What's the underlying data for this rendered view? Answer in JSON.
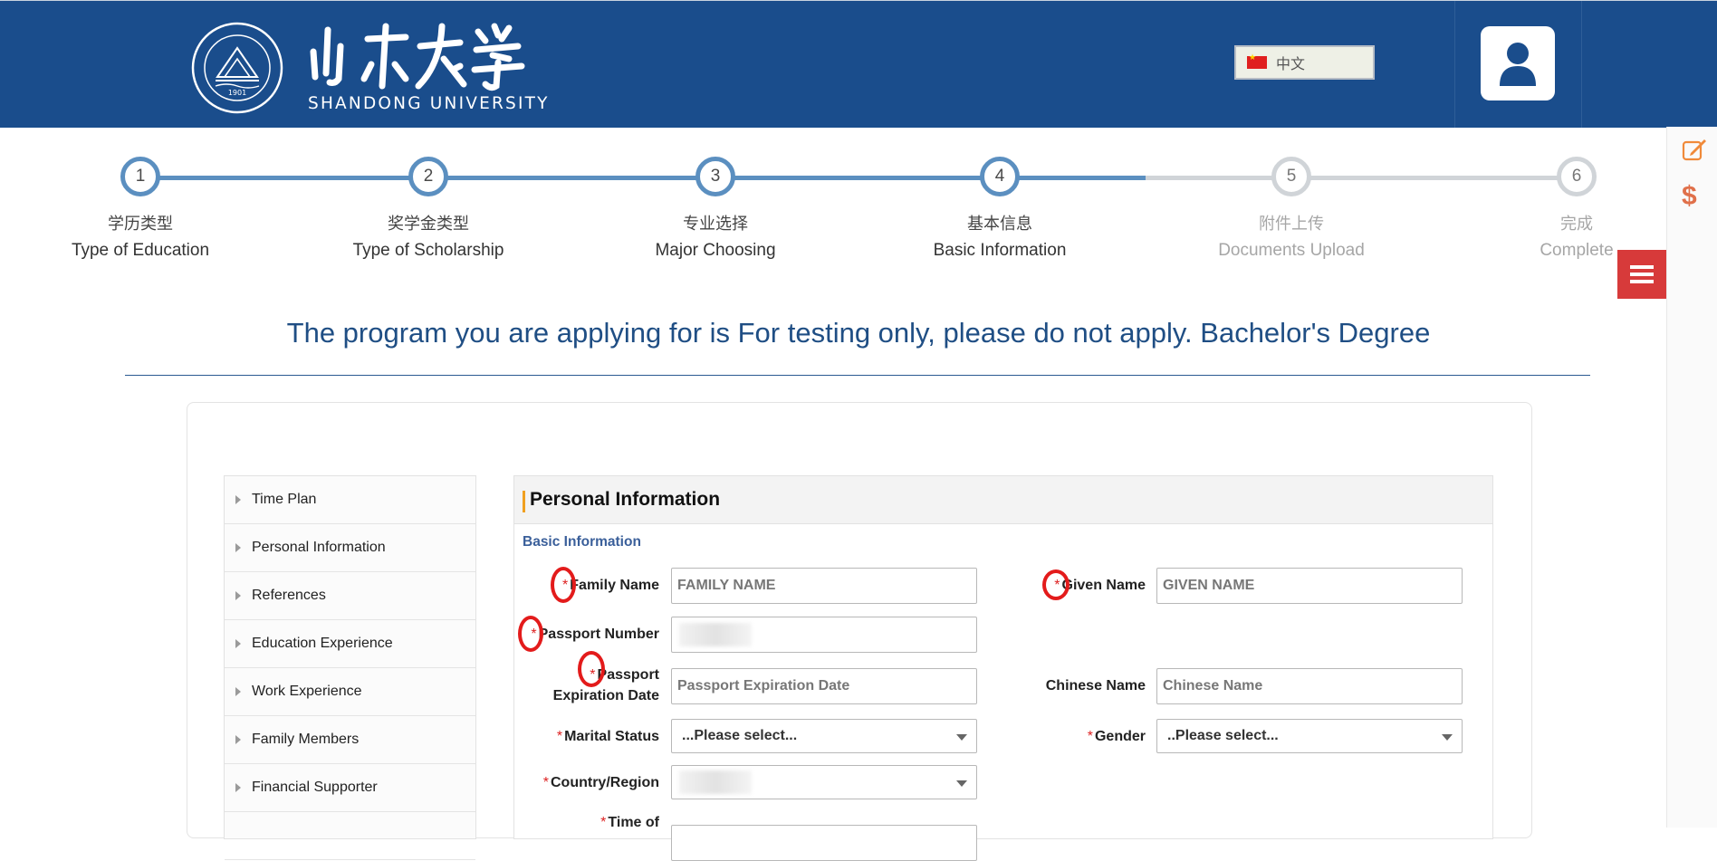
{
  "header": {
    "university_cn": "山东大学",
    "university_en": "SHANDONG UNIVERSITY",
    "seal_year": "1901",
    "seal_ring_text": "SHANDONG UNIVERSITY",
    "language_button": "中文",
    "brand_color": "#1a4d8c"
  },
  "steps": [
    {
      "num": "1",
      "cn": "学历类型",
      "en": "Type of Education",
      "state": "done"
    },
    {
      "num": "2",
      "cn": "奖学金类型",
      "en": "Type of Scholarship",
      "state": "done"
    },
    {
      "num": "3",
      "cn": "专业选择",
      "en": "Major Choosing",
      "state": "done"
    },
    {
      "num": "4",
      "cn": "基本信息",
      "en": "Basic Information",
      "state": "current"
    },
    {
      "num": "5",
      "cn": "附件上传",
      "en": "Documents Upload",
      "state": "pending"
    },
    {
      "num": "6",
      "cn": "完成",
      "en": "Complete",
      "state": "pending"
    }
  ],
  "program_title": "The program you are applying for is For testing only, please do not apply. Bachelor's Degree",
  "sidebar": {
    "items": [
      {
        "label": "Time Plan"
      },
      {
        "label": "Personal Information"
      },
      {
        "label": "References"
      },
      {
        "label": "Education Experience"
      },
      {
        "label": "Work Experience"
      },
      {
        "label": "Family Members"
      },
      {
        "label": "Financial Supporter"
      }
    ]
  },
  "form": {
    "panel_title": "Personal Information",
    "section_title": "Basic Information",
    "family_name": {
      "label": "Family Name",
      "placeholder": "FAMILY NAME",
      "required": "*"
    },
    "given_name": {
      "label": "Given Name",
      "placeholder": "GIVEN NAME",
      "required": "*"
    },
    "passport_number": {
      "label": "Passport Number",
      "required": "*"
    },
    "passport_expiration": {
      "label_line1": "Passport",
      "label_line2": "Expiration Date",
      "placeholder": "Passport Expiration Date",
      "required": "*"
    },
    "chinese_name": {
      "label": "Chinese Name",
      "placeholder": "Chinese Name"
    },
    "marital_status": {
      "label": "Marital Status",
      "value": "...Please select...",
      "required": "*"
    },
    "gender": {
      "label": "Gender",
      "value": "..Please select...",
      "required": "*"
    },
    "country_region": {
      "label": "Country/Region",
      "required": "*"
    },
    "time_of": {
      "label": "Time of",
      "required": "*"
    }
  },
  "icons": {
    "edit": "edit-icon",
    "dollar": "dollar-icon",
    "menu": "menu-icon",
    "user": "user-icon"
  },
  "colors": {
    "accent_progress": "#5b8fc0",
    "pending_progress": "#d0d4d8",
    "annotation_ring": "#e31b1b",
    "menu_toggle": "#d73a3a"
  }
}
